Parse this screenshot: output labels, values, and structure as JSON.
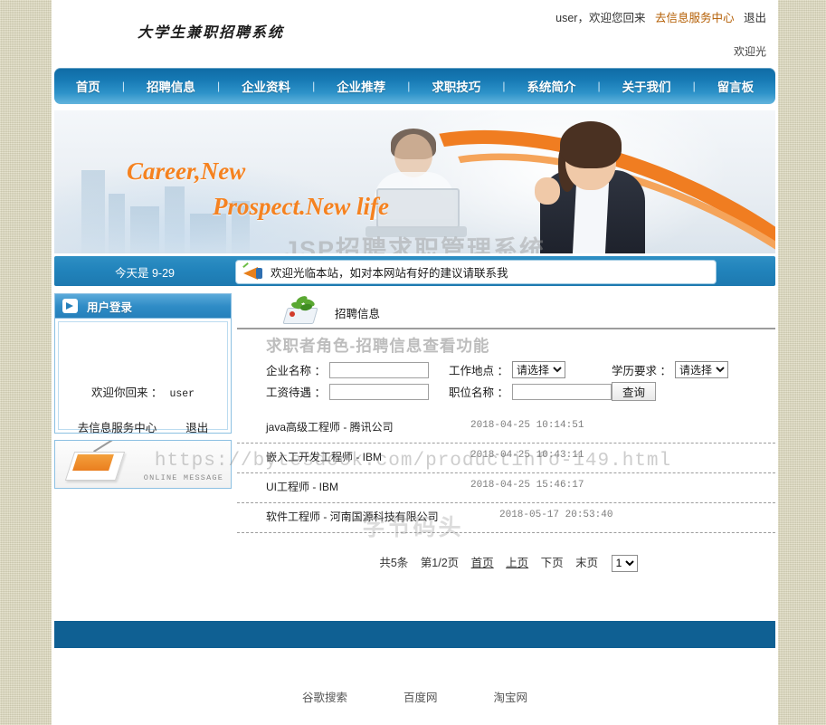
{
  "header": {
    "logo_text": "大学生兼职招聘系统",
    "user_name": "user",
    "user_greeting": "，欢迎您回来",
    "info_center_link": "去信息服务中心",
    "logout_link": "退出",
    "welcome_line": "欢迎光"
  },
  "nav": {
    "separator": "|",
    "items": [
      {
        "label": "首页"
      },
      {
        "label": "招聘信息"
      },
      {
        "label": "企业资料"
      },
      {
        "label": "企业推荐"
      },
      {
        "label": "求职技巧"
      },
      {
        "label": "系统简介"
      },
      {
        "label": "关于我们"
      },
      {
        "label": "留言板"
      }
    ]
  },
  "banner": {
    "slogan_line1": "Career,New",
    "slogan_line2": "Prospect.New life",
    "watermark": "JSP招聘求职管理系统"
  },
  "infobar": {
    "today_label": "今天是 9-29",
    "notice": "欢迎光临本站，如对本网站有好的建议请联系我"
  },
  "sidebar": {
    "login_title": "用户登录",
    "welcome_label": "欢迎你回来 ：",
    "welcome_value": "user",
    "links": [
      {
        "label": "去信息服务中心"
      },
      {
        "label": "退出"
      }
    ],
    "message_image_label": "ONLINE MESSAGE"
  },
  "content": {
    "section_title": "招聘信息",
    "page_heading": "求职者角色-招聘信息查看功能",
    "form": {
      "company_label": "企业名称 ：",
      "company_value": "",
      "company_placeholder": "",
      "location_label": "工作地点 ：",
      "location_selected": "请选择",
      "location_options": [
        "请选择"
      ],
      "education_label": "学历要求 ：",
      "education_selected": "请选择",
      "education_options": [
        "请选择"
      ],
      "salary_label": "工资待遇 ：",
      "salary_value": "",
      "position_label": "职位名称 ：",
      "position_value": "",
      "query_button": "查询"
    },
    "jobs": [
      {
        "title": "java高级工程师 - 腾讯公司",
        "date": "2018-04-25 10:14:51"
      },
      {
        "title": "嵌入工开发工程师 - IBM",
        "date": "2018-04-25 10:43:11"
      },
      {
        "title": "UI工程师 - IBM",
        "date": "2018-04-25 15:46:17"
      },
      {
        "title": "软件工程师 - 河南国源科技有限公司",
        "date": "2018-05-17 20:53:40"
      }
    ],
    "pagination": {
      "total": "共5条",
      "page_info": "第1/2页",
      "first": "首页",
      "prev": "上页",
      "next": "下页",
      "last": "末页",
      "selected_page": "1",
      "page_options": [
        "1",
        "2"
      ]
    }
  },
  "footer": {
    "links": [
      {
        "label": "谷歌搜索"
      },
      {
        "label": "百度网"
      },
      {
        "label": "淘宝网"
      }
    ]
  },
  "watermarks": {
    "url": "https://bytesdock.com/productinfo-149.html",
    "brand": "字节码头"
  }
}
